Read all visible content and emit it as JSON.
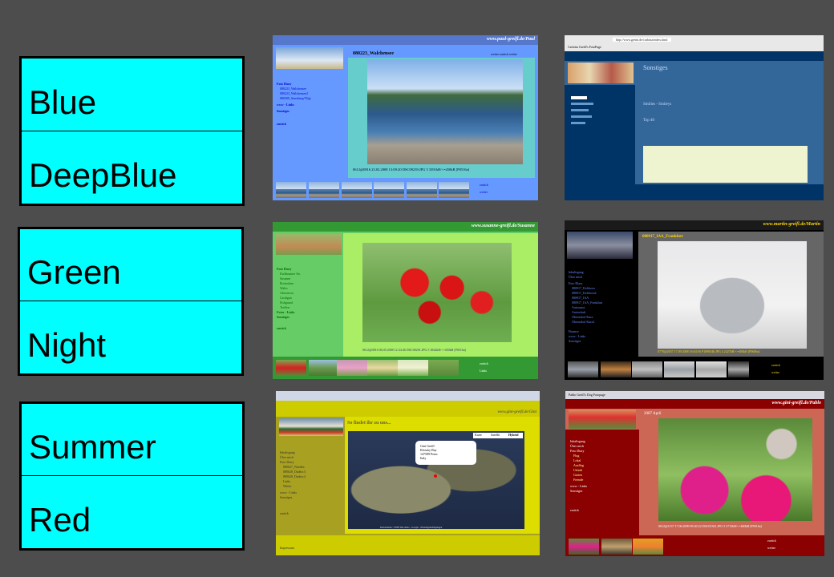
{
  "labels": [
    {
      "top": "Blue",
      "bottom": "DeepBlue"
    },
    {
      "top": "Green",
      "bottom": "Night"
    },
    {
      "top": "Summer",
      "bottom": "Red"
    }
  ],
  "blue": {
    "site": "www.paul-greifl.de/Paul",
    "photo_title": "080223_Walchensee",
    "nav_links": "weiter zurück weiter",
    "menu": [
      "Foto Diary",
      "080223_Walchensee",
      "080223_Walchensee2",
      "080309_Starnberg/Vilgi",
      "www - Links",
      "Sonstiges",
      "zurück"
    ],
    "caption": "0612@0816 23.02.2008 13:09:20 DSC09239.JPG 5 3391kB/<=450kB [P0516a]",
    "bottom_links": [
      "zurück",
      "weiter"
    ]
  },
  "deepblue": {
    "tab": "Carlotta Greifl's FotoPage",
    "url": "http://www.greini.de/carlotta/index.html",
    "heading": "Sonstiges",
    "sub": "Smilies - Smileys",
    "sub2": "Top 40"
  },
  "green": {
    "site": "www.susanne-greifl.de/Susanne",
    "menu": [
      "Foto Diary",
      "Eselbrunner Str.",
      "Susanne",
      "Rotterdam",
      "Wales",
      "Aberaeron",
      "Cardigan",
      "Fishguard",
      "Treffen",
      "Fotos - Links",
      "Sonstiges",
      "zurück"
    ],
    "caption": "0612@0816 06.05.2008 12:34:46 DSC00291.JPG 5 3824kB/<=450kB [P0516a]",
    "bottom_links": [
      "zurück",
      "Links"
    ]
  },
  "night": {
    "site": "www.martin-greifl.de/Martin",
    "photo_title": "080917_IAA_Frankfurt",
    "menu": [
      "Inhaltsgang",
      "Über mich",
      "Foto Diary",
      "080917_Eichhorn",
      "080917_Eichhorn2",
      "080917_IAA",
      "080917_IAA_Frankfurt",
      "Autoausst.",
      "Autoschuh",
      "Oberstdorf Kurz",
      "Oberstdorf Kurz2",
      "Finance",
      "www - Links",
      "Sonstiges"
    ],
    "caption": "0770@2037 17.09.2008 16:04:56 P1090546.JPG 4 2427kB/<=400kB [P0606a]",
    "bottom_links": [
      "zurück",
      "weiter"
    ]
  },
  "summer": {
    "site": "www.gini-greifl.de/Gini",
    "heading": "So findet ihr zu uns...",
    "map_buttons": [
      "Karte",
      "Satellit",
      "Hybrid"
    ],
    "balloon": [
      "Gini Greifl",
      "Klossky Bay",
      "147589 Perm",
      "Italy"
    ],
    "menu": [
      "Inhaltsgang",
      "Über mich",
      "Foto Diary",
      "080627_Nueden",
      "080628_Dadesc3",
      "080628_Dadesc4",
      "Links",
      "Wetter",
      "www - Links",
      "Sonstiges",
      "zurück"
    ],
    "footer": "Impressum",
    "map_footer": "Kartendaten ©2008 Tele Atlas - Google - Nutzungsbedingungen"
  },
  "red": {
    "tab": "Pablo Greifl's Dog Fotopage",
    "site": "www.gini-greifl.de/Pablo",
    "photo_title": "2007 April",
    "menu": [
      "Inhaltsgang",
      "Über mich",
      "Foto Diary",
      "Flug",
      "Lokal",
      "Ausflug",
      "Urlaub",
      "Garten",
      "Fremde",
      "www - Links",
      "Sonstiges",
      "zurück"
    ],
    "caption": "0612@1137 17.06.2009 09:40:22 DSC01361.JPG 5 3715kB/<=460kB [P0516a]",
    "bottom_links": [
      "zurück",
      "weiter"
    ]
  },
  "colors": {
    "label_bg": "#00ffff",
    "page_bg": "#4d4d4d"
  }
}
